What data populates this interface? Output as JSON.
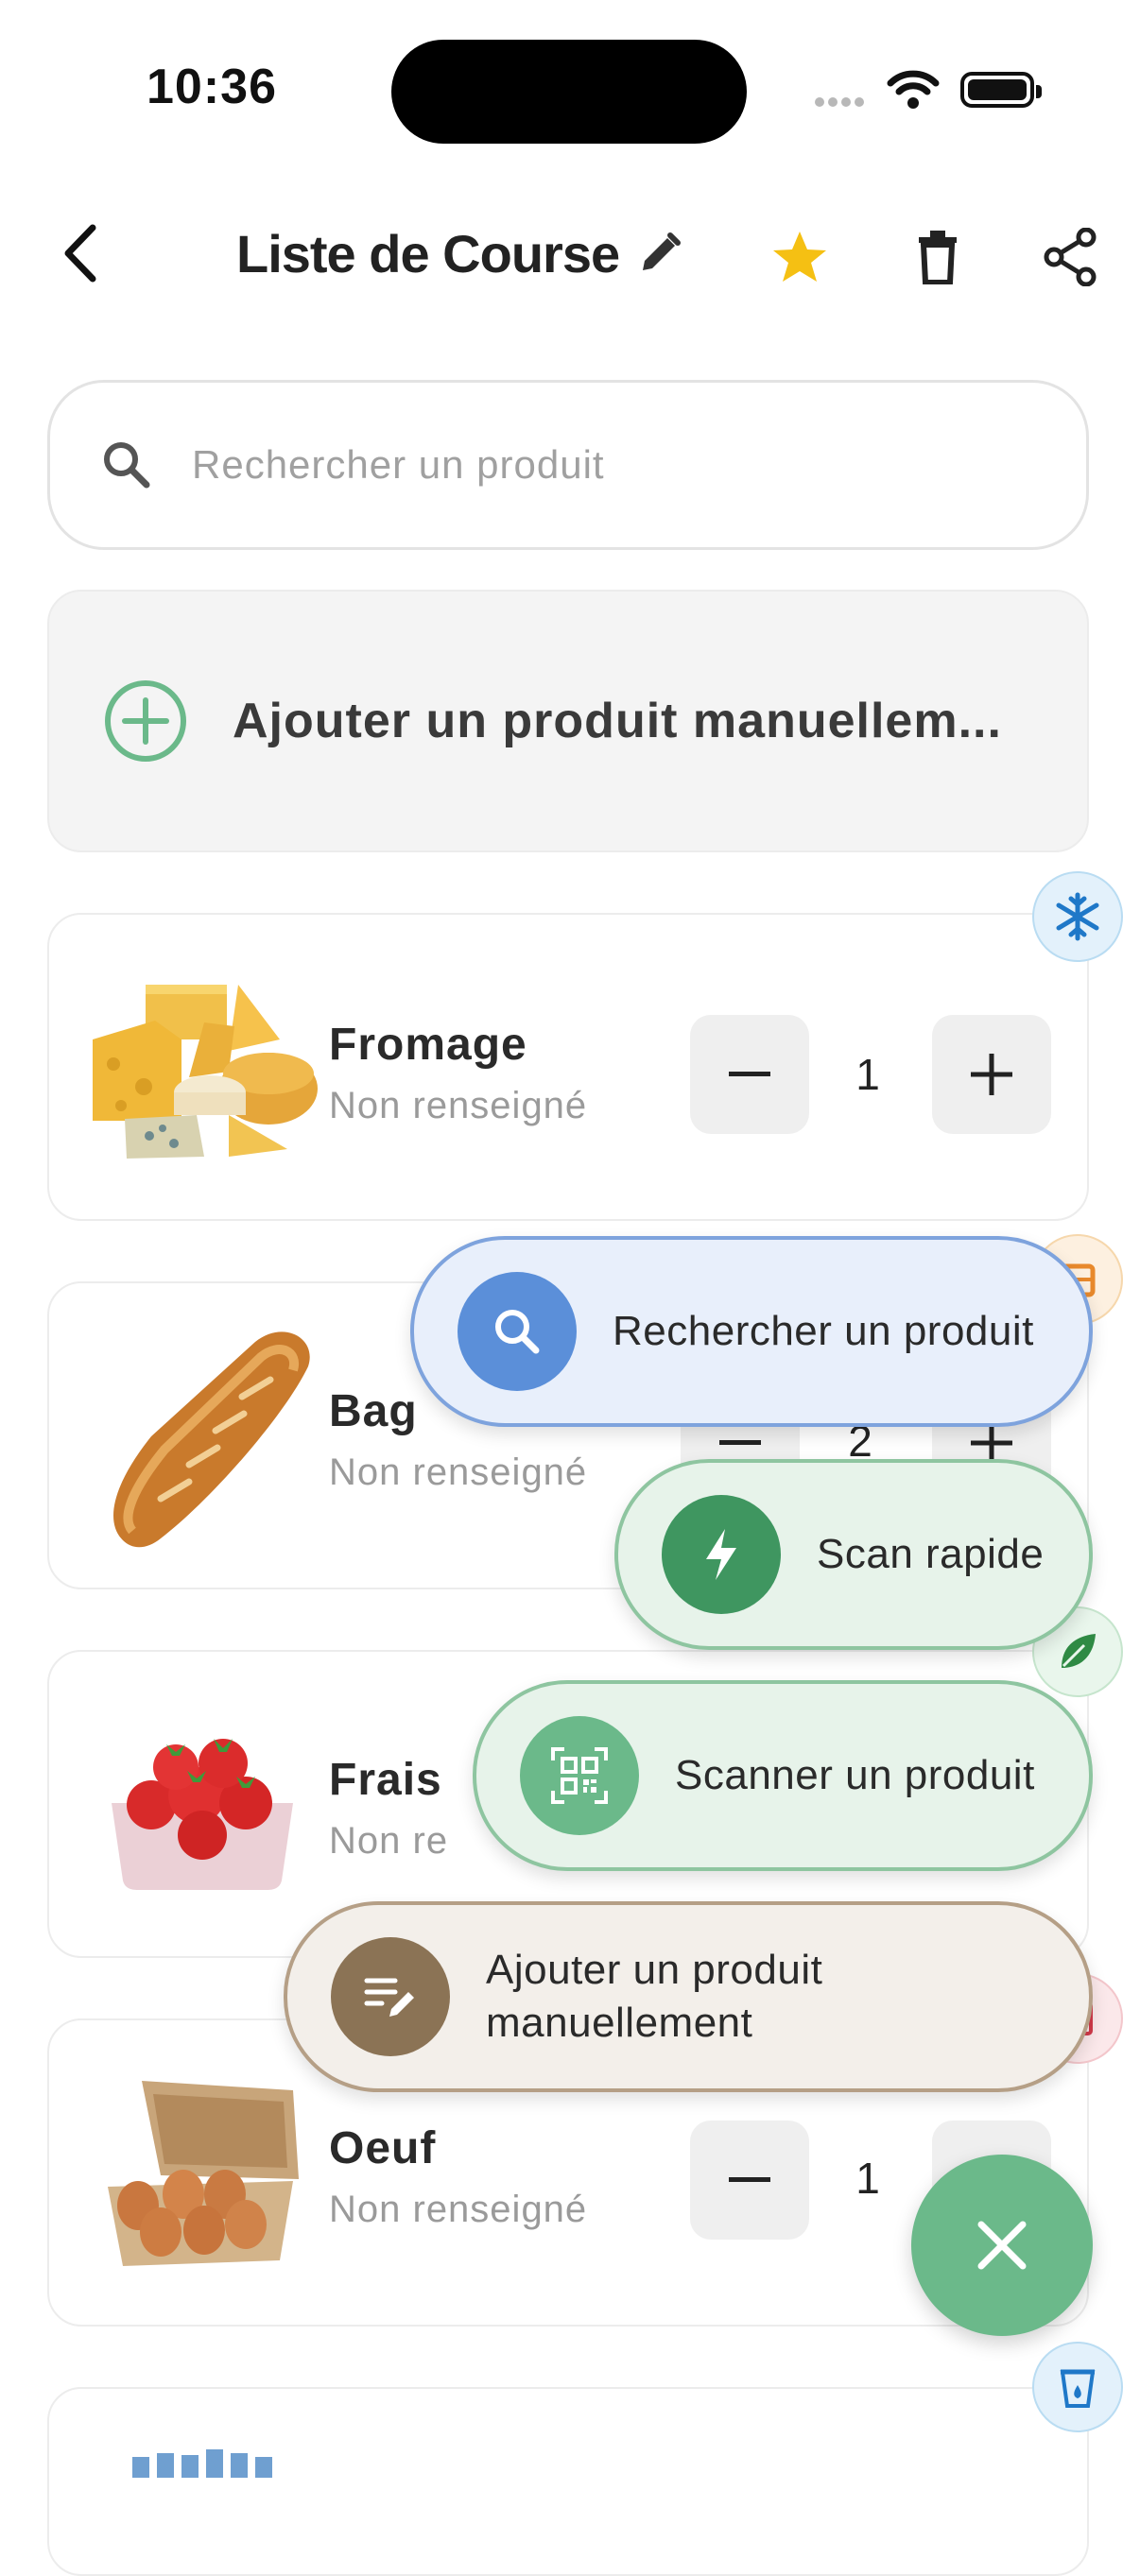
{
  "status_bar": {
    "time": "10:36"
  },
  "header": {
    "title": "Liste de Course",
    "back_icon": "chevron-left-icon",
    "edit_icon": "pencil-icon",
    "favorite_icon": "star-icon",
    "delete_icon": "trash-icon",
    "share_icon": "share-icon"
  },
  "search": {
    "placeholder": "Rechercher un produit",
    "value": ""
  },
  "add_manual": {
    "label": "Ajouter un produit manuellem..."
  },
  "products": [
    {
      "name": "Fromage",
      "subtitle": "Non renseigné",
      "quantity": "1",
      "category_icon": "snowflake-icon"
    },
    {
      "name": "Bag",
      "subtitle": "Non renseigné",
      "quantity": "2",
      "category_icon": "bread-icon"
    },
    {
      "name": "Frais",
      "subtitle": "Non re",
      "quantity": "",
      "category_icon": "leaf-icon"
    },
    {
      "name": "Oeuf",
      "subtitle": "Non renseigné",
      "quantity": "1",
      "category_icon": "egg-box-icon"
    }
  ],
  "fab_menu": {
    "search": {
      "label": "Rechercher un produit",
      "icon": "search-icon"
    },
    "quick_scan": {
      "label": "Scan rapide",
      "icon": "lightning-icon"
    },
    "scan": {
      "label": "Scanner un produit",
      "icon": "qr-scan-icon"
    },
    "manual": {
      "label_line1": "Ajouter un produit",
      "label_line2": "manuellement",
      "icon": "edit-list-icon"
    },
    "close_icon": "close-icon"
  },
  "colors": {
    "accent_green": "#6bb98a",
    "search_blue": "#5b8fd9",
    "manual_brown": "#8b7355",
    "star": "#f5c013"
  }
}
